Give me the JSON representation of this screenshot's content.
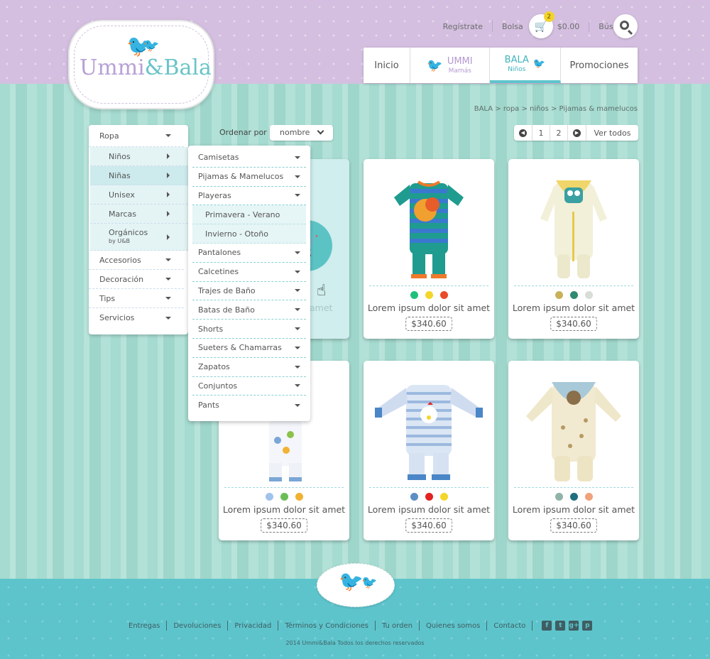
{
  "header": {
    "logo_text_1": "Ummi",
    "logo_text_amp": "&",
    "logo_text_2": "Bala",
    "register": "Regístrate",
    "bag": "Bolsa",
    "cart_count": "2",
    "cart_total": "$0.00",
    "search": "Búsqueda"
  },
  "nav": [
    {
      "label": "Inicio",
      "sub": ""
    },
    {
      "label": "UMMI",
      "sub": "Mamás"
    },
    {
      "label": "BALA",
      "sub": "Niños"
    },
    {
      "label": "Promociones",
      "sub": ""
    }
  ],
  "breadcrumb": "BALA > ropa > niños > Pijamas & mamelucos",
  "sort": {
    "label": "Ordenar por",
    "value": "nombre"
  },
  "pager": {
    "pages": [
      "1",
      "2"
    ],
    "view_all": "Ver todos"
  },
  "sidebar": {
    "top": "Ropa",
    "subs": [
      "Niños",
      "Niñas",
      "Unisex",
      "Marcas",
      "Orgánicos",
      "by U&B"
    ],
    "rest": [
      "Accesorios",
      "Decoración",
      "Tips",
      "Servicios"
    ]
  },
  "submenu": {
    "items": [
      "Camisetas",
      "Pijamas & Mamelucos",
      "Playeras",
      "Primavera - Verano",
      "Invierno - Otoño",
      "Pantalones",
      "Calcetines",
      "Trajes de Baño",
      "Batas de Baño",
      "Shorts",
      "Sueters & Chamarras",
      "Zapatos",
      "Conjuntos",
      "Pants"
    ]
  },
  "products": [
    {
      "name": "Lorem ipsum dolor sit amet",
      "price": "$340.60",
      "colors": [
        "#1fc07e",
        "#f4d62a",
        "#ea4b2a"
      ]
    },
    {
      "name": "Lorem ipsum dolor sit amet",
      "price": "$340.60",
      "colors": [
        "#c8b15a",
        "#2e8a70",
        "#d8ddd8"
      ]
    },
    {
      "name": "Lorem ipsum dolor sit amet",
      "price": "$340.60",
      "colors": [
        "#9fc3ea",
        "#6bbd57",
        "#f0b232"
      ]
    },
    {
      "name": "Lorem ipsum dolor sit amet",
      "price": "$340.60",
      "colors": [
        "#5b8fc4",
        "#e32222",
        "#f4d62a"
      ]
    },
    {
      "name": "Lorem ipsum dolor sit amet",
      "price": "$340.60",
      "colors": [
        "#8fb3a8",
        "#1f6f7e",
        "#f0a27a"
      ]
    }
  ],
  "hover_ghost": "amet",
  "footer": {
    "links": [
      "Entregas",
      "Devoluciones",
      "Privacidad",
      "Términos y Condiciones",
      "Tu orden",
      "Quienes somos",
      "Contacto"
    ],
    "copyright": "2014 Ummi&Bala Todos los derechos reservados",
    "social": [
      "f",
      "t",
      "g+",
      "p"
    ]
  }
}
